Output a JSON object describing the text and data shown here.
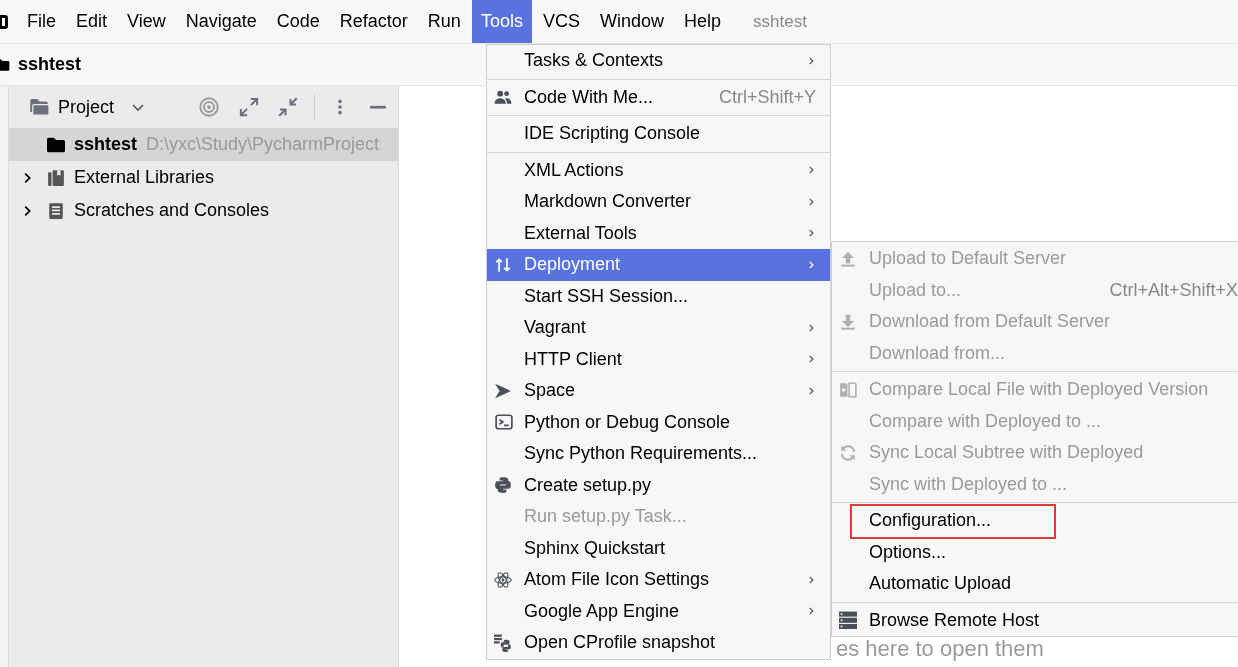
{
  "menu_bar": {
    "items": [
      {
        "label": "File",
        "selected": false
      },
      {
        "label": "Edit",
        "selected": false
      },
      {
        "label": "View",
        "selected": false
      },
      {
        "label": "Navigate",
        "selected": false
      },
      {
        "label": "Code",
        "selected": false
      },
      {
        "label": "Refactor",
        "selected": false
      },
      {
        "label": "Run",
        "selected": false
      },
      {
        "label": "Tools",
        "selected": true
      },
      {
        "label": "VCS",
        "selected": false
      },
      {
        "label": "Window",
        "selected": false
      },
      {
        "label": "Help",
        "selected": false
      }
    ],
    "project_title": "sshtest"
  },
  "navigation_bar": {
    "project": "sshtest"
  },
  "project_panel": {
    "title": "Project",
    "tree": [
      {
        "kind": "project",
        "label": "sshtest",
        "path": "D:\\yxc\\Study\\PycharmProject",
        "expandable": false,
        "selected": true
      },
      {
        "kind": "library",
        "label": "External Libraries",
        "expandable": true,
        "selected": false
      },
      {
        "kind": "scratches",
        "label": "Scratches and Consoles",
        "expandable": true,
        "selected": false
      }
    ]
  },
  "tools_menu": {
    "groups": [
      [
        {
          "label": "Tasks & Contexts",
          "submenu": true,
          "disabled": false,
          "selected": false
        }
      ],
      [
        {
          "kind": "people",
          "label": "Code With Me...",
          "shortcut": "Ctrl+Shift+Y",
          "submenu": false,
          "disabled": false,
          "selected": false
        }
      ],
      [
        {
          "label": "IDE Scripting Console",
          "submenu": false,
          "disabled": false,
          "selected": false
        }
      ],
      [
        {
          "label": "XML Actions",
          "submenu": true,
          "disabled": false,
          "selected": false
        },
        {
          "label": "Markdown Converter",
          "submenu": true,
          "disabled": false,
          "selected": false
        },
        {
          "label": "External Tools",
          "submenu": true,
          "disabled": false,
          "selected": false
        },
        {
          "kind": "updown",
          "label": "Deployment",
          "submenu": true,
          "disabled": false,
          "selected": true
        },
        {
          "label": "Start SSH Session...",
          "submenu": false,
          "disabled": false,
          "selected": false
        },
        {
          "label": "Vagrant",
          "submenu": true,
          "disabled": false,
          "selected": false
        },
        {
          "label": "HTTP Client",
          "submenu": true,
          "disabled": false,
          "selected": false
        },
        {
          "kind": "space",
          "label": "Space",
          "submenu": true,
          "disabled": false,
          "selected": false
        },
        {
          "kind": "console",
          "label": "Python or Debug Console",
          "submenu": false,
          "disabled": false,
          "selected": false
        },
        {
          "label": "Sync Python Requirements...",
          "submenu": false,
          "disabled": false,
          "selected": false
        },
        {
          "kind": "python",
          "label": "Create setup.py",
          "submenu": false,
          "disabled": false,
          "selected": false
        },
        {
          "label": "Run setup.py Task...",
          "submenu": false,
          "disabled": true,
          "selected": false
        },
        {
          "label": "Sphinx Quickstart",
          "submenu": false,
          "disabled": false,
          "selected": false
        },
        {
          "kind": "atom",
          "label": "Atom File Icon Settings",
          "submenu": true,
          "disabled": false,
          "selected": false
        },
        {
          "label": "Google App Engine",
          "submenu": true,
          "disabled": false,
          "selected": false
        },
        {
          "kind": "cprofile",
          "label": "Open CProfile snapshot",
          "submenu": false,
          "disabled": false,
          "selected": false
        }
      ]
    ]
  },
  "deployment_menu": {
    "groups": [
      [
        {
          "kind": "upload",
          "label": "Upload to Default Server",
          "disabled": true,
          "selected": false,
          "highlighted": false
        },
        {
          "label": "Upload to...",
          "shortcut": "Ctrl+Alt+Shift+X",
          "disabled": true,
          "selected": false,
          "highlighted": false
        },
        {
          "kind": "download",
          "label": "Download from Default Server",
          "disabled": true,
          "selected": false,
          "highlighted": false
        },
        {
          "label": "Download from...",
          "disabled": true,
          "selected": false,
          "highlighted": false
        }
      ],
      [
        {
          "kind": "compare",
          "label": "Compare Local File with Deployed Version",
          "disabled": true,
          "selected": false,
          "highlighted": false
        },
        {
          "label": "Compare with Deployed to ...",
          "disabled": true,
          "selected": false,
          "highlighted": false
        },
        {
          "kind": "sync",
          "label": "Sync Local Subtree with Deployed",
          "disabled": true,
          "selected": false,
          "highlighted": false
        },
        {
          "label": "Sync with Deployed to ...",
          "disabled": true,
          "selected": false,
          "highlighted": false
        }
      ],
      [
        {
          "label": "Configuration...",
          "disabled": false,
          "selected": false,
          "highlighted": true
        },
        {
          "label": "Options...",
          "disabled": false,
          "selected": false,
          "highlighted": false
        },
        {
          "label": "Automatic Upload",
          "disabled": false,
          "selected": false,
          "highlighted": false
        }
      ],
      [
        {
          "kind": "server",
          "label": "Browse Remote Host",
          "disabled": false,
          "selected": false,
          "highlighted": false
        }
      ]
    ]
  },
  "editor": {
    "hint": "es here to open them"
  }
}
